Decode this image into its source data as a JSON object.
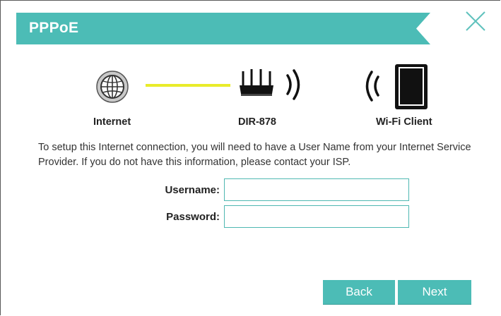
{
  "dialog": {
    "title": "PPPoE",
    "close_label": "Close",
    "colors": {
      "accent": "#4cbcb6",
      "line": "#e9ec2a",
      "close": "#5fc2bd"
    }
  },
  "diagram": {
    "nodes": [
      {
        "label": "Internet",
        "icon": "globe-icon"
      },
      {
        "label": "DIR-878",
        "icon": "router-icon"
      },
      {
        "label": "Wi-Fi Client",
        "icon": "tablet-icon"
      }
    ]
  },
  "description": "To setup this Internet connection, you will need to have a User Name from your Internet Service Provider. If you do not have this information, please contact your ISP.",
  "form": {
    "username_label": "Username:",
    "username_value": "",
    "password_label": "Password:",
    "password_value": ""
  },
  "buttons": {
    "back": "Back",
    "next": "Next"
  }
}
